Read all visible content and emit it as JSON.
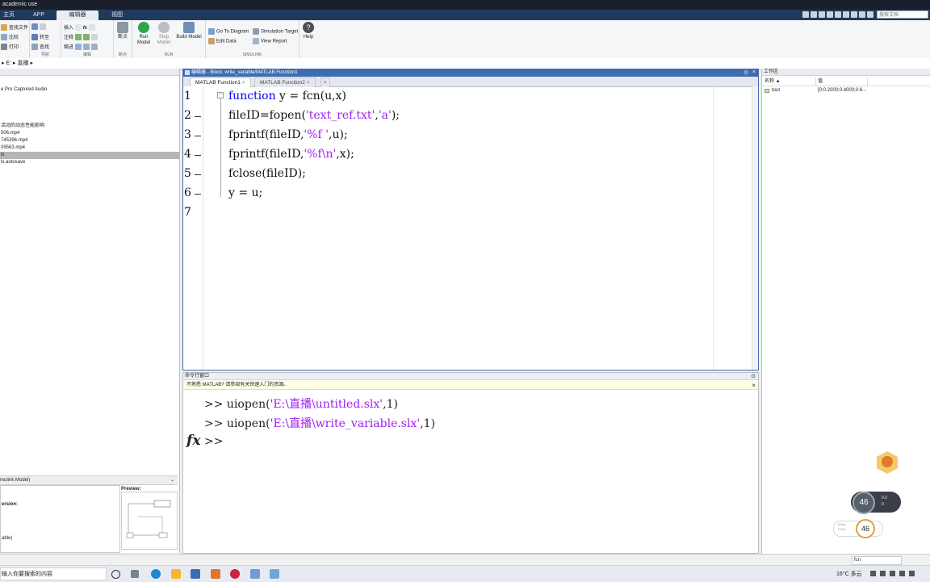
{
  "title_bar": {
    "text": "academic use"
  },
  "ribbon_tabs": [
    "主页",
    "APP",
    "编辑器",
    "视图"
  ],
  "search": {
    "placeholder": "搜索文档"
  },
  "ribbon": {
    "file_group": {
      "find_files": "查找文件",
      "compare": "比较",
      "print": "打印"
    },
    "nav_group": {
      "comment": "注释",
      "indent": "缩进",
      "find": "查找",
      "goto": "转至",
      "insert": "插入",
      "caption": "导航"
    },
    "edit_caption": "编辑",
    "breakpoints": {
      "label": "断点",
      "caption": "断点"
    },
    "run": {
      "run_label": "Run\nModel",
      "stop_label": "Stop\nModel",
      "build_label": "Build Model",
      "caption": "RUN"
    },
    "simulink": {
      "go_to_diagram": "Go To Diagram",
      "edit_data": "Edit Data",
      "simulation_target": "Simulation Target",
      "view_report": "View Report",
      "caption": "SIMULINK"
    },
    "help": {
      "label": "Help"
    }
  },
  "breadcrumb": {
    "drive": "E:",
    "folder": "直播"
  },
  "file_browser": {
    "items": [
      {
        "name": "e Pro Captured Audio",
        "selected": false
      },
      {
        "name": "活动的动态性能影响",
        "selected": false
      },
      {
        "name": "506.mp4",
        "selected": false
      },
      {
        "name": "745396.mp4",
        "selected": false
      },
      {
        "name": "09563.mp4",
        "selected": false
      },
      {
        "name": "lx",
        "selected": true
      },
      {
        "name": "lx.autosave",
        "selected": false
      }
    ],
    "details_header": "mulink Model)",
    "details_version": "ersion:",
    "details_footer": "able)",
    "preview_label": "Preview:"
  },
  "editor": {
    "window_title": "编辑器 - Block: write_variable/MATLAB Function1",
    "tabs": [
      "MATLAB Function1",
      "MATLAB Function2"
    ],
    "lines": [
      {
        "num": "1",
        "parts": [
          [
            "kw",
            "function"
          ],
          [
            "n",
            " y = fcn(u,x)"
          ]
        ]
      },
      {
        "num": "2",
        "parts": [
          [
            "n",
            "fileID=fopen("
          ],
          [
            "str",
            "'text_ref.txt'"
          ],
          [
            "n",
            ","
          ],
          [
            "str",
            "'a'"
          ],
          [
            "n",
            ");"
          ]
        ]
      },
      {
        "num": "3",
        "parts": [
          [
            "n",
            "fprintf(fileID,"
          ],
          [
            "str",
            "'%f '"
          ],
          [
            "n",
            ",u);"
          ]
        ]
      },
      {
        "num": "4",
        "parts": [
          [
            "n",
            "fprintf(fileID,"
          ],
          [
            "str",
            "'%f\\n'"
          ],
          [
            "n",
            ",x);"
          ]
        ]
      },
      {
        "num": "5",
        "parts": [
          [
            "n",
            "fclose(fileID);"
          ]
        ]
      },
      {
        "num": "6",
        "parts": [
          [
            "n",
            "y = u;"
          ]
        ]
      },
      {
        "num": "7",
        "parts": []
      }
    ]
  },
  "command_window": {
    "title": "命令行窗口",
    "notice": "不熟悉 MATLAB? 请参阅有关快速入门的资源。",
    "history": [
      {
        "prompt": ">> ",
        "parts": [
          [
            "n",
            "uiopen("
          ],
          [
            "str",
            "'E:\\直播\\untitled.slx'"
          ],
          [
            "n",
            ",1)"
          ]
        ]
      },
      {
        "prompt": ">> ",
        "parts": [
          [
            "n",
            "uiopen("
          ],
          [
            "str",
            "'E:\\直播\\write_variable.slx'"
          ],
          [
            "n",
            ",1)"
          ]
        ]
      }
    ],
    "fx_label": "fx",
    "current_prompt": ">>"
  },
  "workspace": {
    "title": "工作区",
    "col_name": "名称 ▲",
    "col_value": "值",
    "rows": [
      {
        "name": "tout",
        "value": "[0;0.2000;0.4000;0.6..."
      }
    ]
  },
  "status_bar": {
    "function_name": "fcn"
  },
  "widgets": {
    "gauge_main": "46",
    "gauge_small": "46",
    "net_up": "0.2",
    "net_down": "0",
    "net_small_up": "0 K/s",
    "net_small_down": "0 K/s"
  },
  "taskbar": {
    "search_placeholder": "输入你要搜索的内容",
    "weather": "16°C 多云"
  }
}
